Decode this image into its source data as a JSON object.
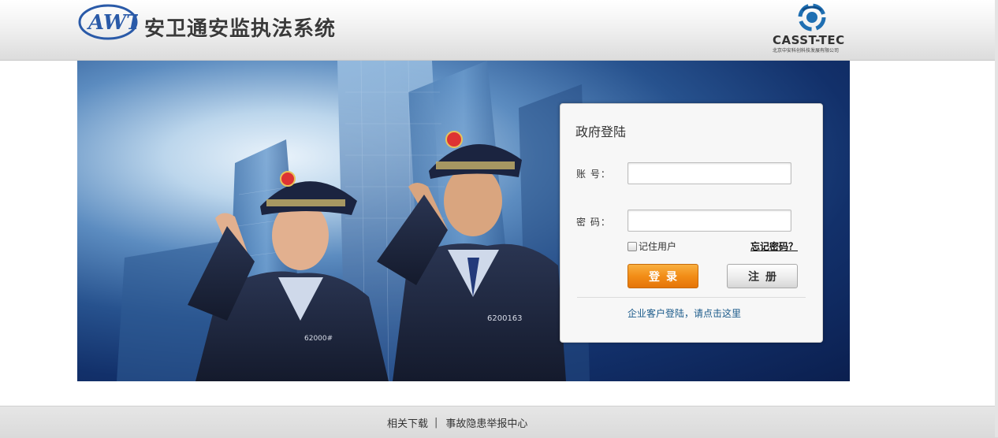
{
  "header": {
    "system_title": "安卫通安监执法系统",
    "logo_text": "AWT",
    "company_name": "CASST-TEC",
    "company_subtitle": "北京中安科创科技发展有限公司"
  },
  "banner": {
    "badge_left": "62000#",
    "badge_right": "6200163"
  },
  "login": {
    "title": "政府登陆",
    "account_label": "账  号：",
    "account_value": "",
    "password_label": "密  码：",
    "password_value": "",
    "remember_label": "记住用户",
    "remember_checked": false,
    "forgot_label": "忘记密码？",
    "login_button": "登录",
    "register_button": "注册",
    "enterprise_link": "企业客户登陆，请点击这里"
  },
  "footer": {
    "links": [
      "相关下载",
      "事故隐患举报中心"
    ],
    "separator": "|"
  },
  "colors": {
    "login_button": "#f28d17",
    "banner_dark": "#0b1f4f",
    "link": "#1a5a8a"
  }
}
